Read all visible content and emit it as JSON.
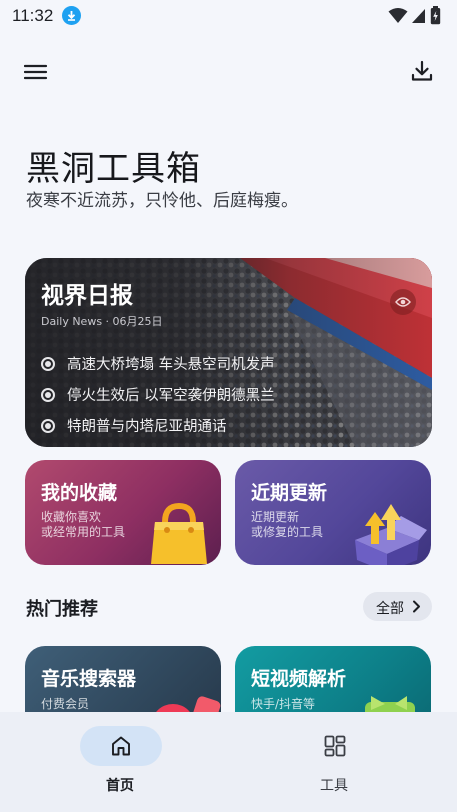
{
  "status_bar": {
    "time": "11:32",
    "notification_icon": "download-badge-icon",
    "icons": [
      "wifi-icon",
      "signal-icon",
      "battery-icon"
    ]
  },
  "app_bar": {
    "menu_icon": "hamburger-menu-icon",
    "download_icon": "download-icon"
  },
  "header": {
    "title": "黑洞工具箱",
    "subtitle": "夜寒不近流苏，只怜他、后庭梅瘦。"
  },
  "daily_news": {
    "title": "视界日报",
    "date": "Daily News · 06月25日",
    "items": [
      "高速大桥垮塌 车头悬空司机发声",
      "停火生效后 以军空袭伊朗德黑兰",
      "特朗普与内塔尼亚胡通话"
    ],
    "visibility_icon": "eye-icon"
  },
  "feature_cards": [
    {
      "title": "我的收藏",
      "desc_lines": [
        "收藏你喜欢",
        "或经常用的工具"
      ],
      "icon": "shopping-bag-icon",
      "color": "#8e2f62"
    },
    {
      "title": "近期更新",
      "desc_lines": [
        "近期更新",
        "或修复的工具"
      ],
      "icon": "upgrade-box-icon",
      "color": "#53479a"
    }
  ],
  "section": {
    "title": "热门推荐",
    "all_label": "全部"
  },
  "recommended": [
    {
      "title": "音乐搜索器",
      "desc": "付费会员",
      "color": "#30485d"
    },
    {
      "title": "短视频解析",
      "desc": "快手/抖音等",
      "color": "#0d8089"
    }
  ],
  "bottom_nav": {
    "items": [
      {
        "label": "首页",
        "icon": "home-icon",
        "active": true
      },
      {
        "label": "工具",
        "icon": "grid-tools-icon",
        "active": false
      }
    ]
  }
}
